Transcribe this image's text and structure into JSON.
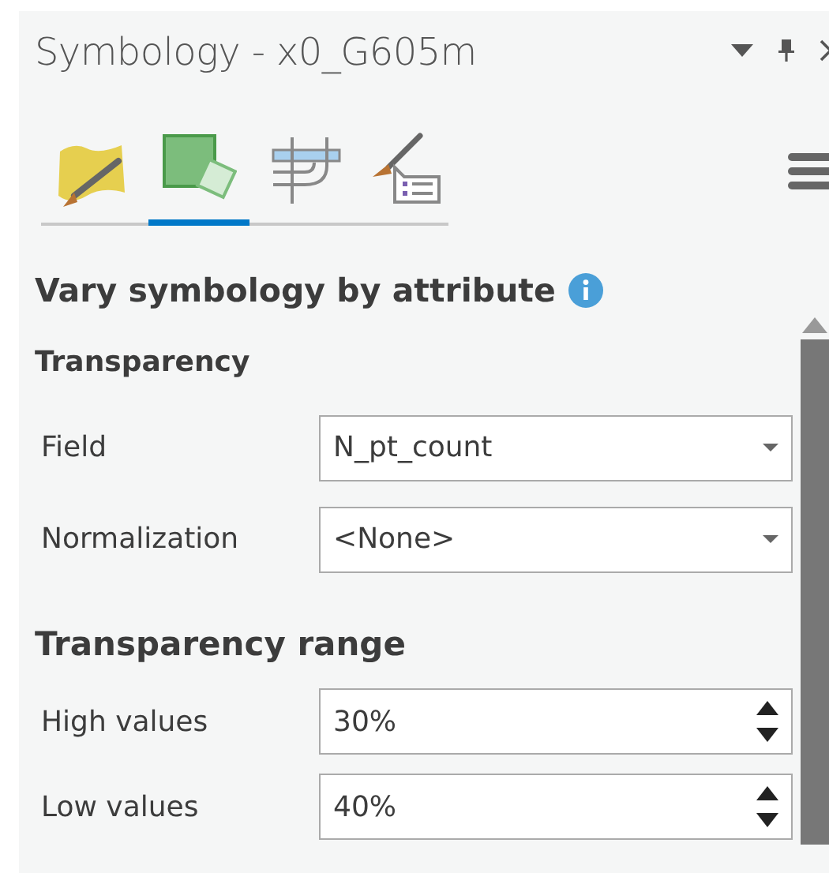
{
  "window": {
    "title": "Symbology - x0_G605m"
  },
  "tabs": [
    {
      "kind": "primary",
      "selected": false
    },
    {
      "kind": "vary",
      "selected": true
    },
    {
      "kind": "vector",
      "selected": false
    },
    {
      "kind": "legend",
      "selected": false
    }
  ],
  "section": {
    "heading": "Vary symbology by attribute"
  },
  "transparency": {
    "title": "Transparency",
    "fields": [
      {
        "label": "Field",
        "value": "N_pt_count",
        "kind": "dropdown"
      },
      {
        "label": "Normalization",
        "value": "<None>",
        "kind": "dropdown"
      }
    ]
  },
  "range": {
    "title": "Transparency range",
    "fields": [
      {
        "label": "High values",
        "value": "30%",
        "kind": "spinner"
      },
      {
        "label": "Low values",
        "value": "40%",
        "kind": "spinner"
      }
    ]
  }
}
